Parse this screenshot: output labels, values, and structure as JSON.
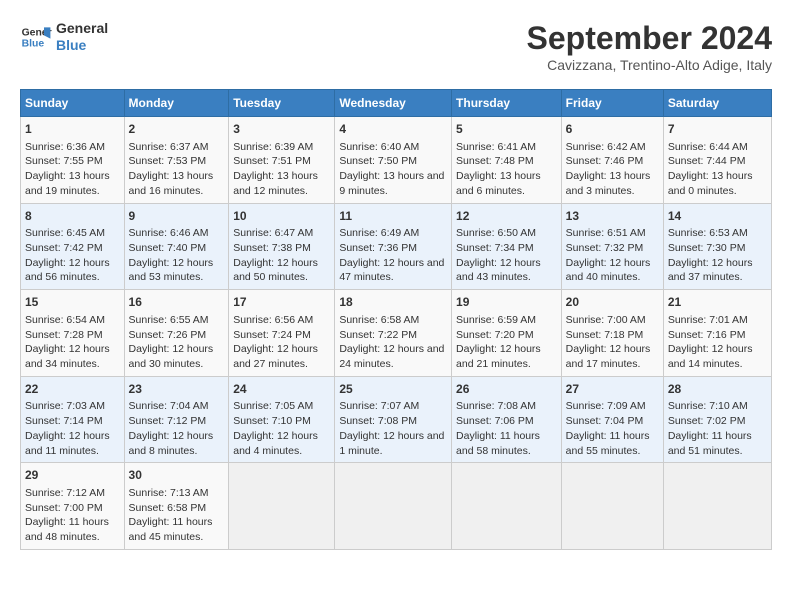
{
  "header": {
    "logo_line1": "General",
    "logo_line2": "Blue",
    "month_title": "September 2024",
    "subtitle": "Cavizzana, Trentino-Alto Adige, Italy"
  },
  "days_of_week": [
    "Sunday",
    "Monday",
    "Tuesday",
    "Wednesday",
    "Thursday",
    "Friday",
    "Saturday"
  ],
  "weeks": [
    [
      {
        "day": "1",
        "info": "Sunrise: 6:36 AM\nSunset: 7:55 PM\nDaylight: 13 hours and 19 minutes."
      },
      {
        "day": "2",
        "info": "Sunrise: 6:37 AM\nSunset: 7:53 PM\nDaylight: 13 hours and 16 minutes."
      },
      {
        "day": "3",
        "info": "Sunrise: 6:39 AM\nSunset: 7:51 PM\nDaylight: 13 hours and 12 minutes."
      },
      {
        "day": "4",
        "info": "Sunrise: 6:40 AM\nSunset: 7:50 PM\nDaylight: 13 hours and 9 minutes."
      },
      {
        "day": "5",
        "info": "Sunrise: 6:41 AM\nSunset: 7:48 PM\nDaylight: 13 hours and 6 minutes."
      },
      {
        "day": "6",
        "info": "Sunrise: 6:42 AM\nSunset: 7:46 PM\nDaylight: 13 hours and 3 minutes."
      },
      {
        "day": "7",
        "info": "Sunrise: 6:44 AM\nSunset: 7:44 PM\nDaylight: 13 hours and 0 minutes."
      }
    ],
    [
      {
        "day": "8",
        "info": "Sunrise: 6:45 AM\nSunset: 7:42 PM\nDaylight: 12 hours and 56 minutes."
      },
      {
        "day": "9",
        "info": "Sunrise: 6:46 AM\nSunset: 7:40 PM\nDaylight: 12 hours and 53 minutes."
      },
      {
        "day": "10",
        "info": "Sunrise: 6:47 AM\nSunset: 7:38 PM\nDaylight: 12 hours and 50 minutes."
      },
      {
        "day": "11",
        "info": "Sunrise: 6:49 AM\nSunset: 7:36 PM\nDaylight: 12 hours and 47 minutes."
      },
      {
        "day": "12",
        "info": "Sunrise: 6:50 AM\nSunset: 7:34 PM\nDaylight: 12 hours and 43 minutes."
      },
      {
        "day": "13",
        "info": "Sunrise: 6:51 AM\nSunset: 7:32 PM\nDaylight: 12 hours and 40 minutes."
      },
      {
        "day": "14",
        "info": "Sunrise: 6:53 AM\nSunset: 7:30 PM\nDaylight: 12 hours and 37 minutes."
      }
    ],
    [
      {
        "day": "15",
        "info": "Sunrise: 6:54 AM\nSunset: 7:28 PM\nDaylight: 12 hours and 34 minutes."
      },
      {
        "day": "16",
        "info": "Sunrise: 6:55 AM\nSunset: 7:26 PM\nDaylight: 12 hours and 30 minutes."
      },
      {
        "day": "17",
        "info": "Sunrise: 6:56 AM\nSunset: 7:24 PM\nDaylight: 12 hours and 27 minutes."
      },
      {
        "day": "18",
        "info": "Sunrise: 6:58 AM\nSunset: 7:22 PM\nDaylight: 12 hours and 24 minutes."
      },
      {
        "day": "19",
        "info": "Sunrise: 6:59 AM\nSunset: 7:20 PM\nDaylight: 12 hours and 21 minutes."
      },
      {
        "day": "20",
        "info": "Sunrise: 7:00 AM\nSunset: 7:18 PM\nDaylight: 12 hours and 17 minutes."
      },
      {
        "day": "21",
        "info": "Sunrise: 7:01 AM\nSunset: 7:16 PM\nDaylight: 12 hours and 14 minutes."
      }
    ],
    [
      {
        "day": "22",
        "info": "Sunrise: 7:03 AM\nSunset: 7:14 PM\nDaylight: 12 hours and 11 minutes."
      },
      {
        "day": "23",
        "info": "Sunrise: 7:04 AM\nSunset: 7:12 PM\nDaylight: 12 hours and 8 minutes."
      },
      {
        "day": "24",
        "info": "Sunrise: 7:05 AM\nSunset: 7:10 PM\nDaylight: 12 hours and 4 minutes."
      },
      {
        "day": "25",
        "info": "Sunrise: 7:07 AM\nSunset: 7:08 PM\nDaylight: 12 hours and 1 minute."
      },
      {
        "day": "26",
        "info": "Sunrise: 7:08 AM\nSunset: 7:06 PM\nDaylight: 11 hours and 58 minutes."
      },
      {
        "day": "27",
        "info": "Sunrise: 7:09 AM\nSunset: 7:04 PM\nDaylight: 11 hours and 55 minutes."
      },
      {
        "day": "28",
        "info": "Sunrise: 7:10 AM\nSunset: 7:02 PM\nDaylight: 11 hours and 51 minutes."
      }
    ],
    [
      {
        "day": "29",
        "info": "Sunrise: 7:12 AM\nSunset: 7:00 PM\nDaylight: 11 hours and 48 minutes."
      },
      {
        "day": "30",
        "info": "Sunrise: 7:13 AM\nSunset: 6:58 PM\nDaylight: 11 hours and 45 minutes."
      },
      {
        "day": "",
        "info": ""
      },
      {
        "day": "",
        "info": ""
      },
      {
        "day": "",
        "info": ""
      },
      {
        "day": "",
        "info": ""
      },
      {
        "day": "",
        "info": ""
      }
    ]
  ]
}
